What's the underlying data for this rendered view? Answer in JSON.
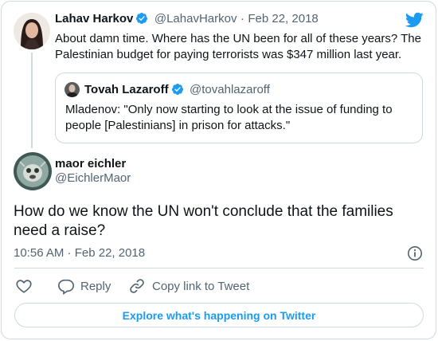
{
  "colors": {
    "accent": "#1d9bf0",
    "text": "#0f1419",
    "muted": "#536471",
    "border": "#cfd9de"
  },
  "parent_tweet": {
    "name": "Lahav Harkov",
    "handle": "@LahavHarkov",
    "separator": "·",
    "date": "Feb 22, 2018",
    "text_line1": "About damn time. Where has the UN been for all of these years? The",
    "text_line2": "Palestinian budget for paying terrorists was $347 million last year.",
    "quoted": {
      "name": "Tovah Lazaroff",
      "handle": "@tovahlazaroff",
      "text_line1": "Mladenov: \"Only now starting to look at the issue of funding to",
      "text_line2": "people [Palestinians] in prison for attacks.\""
    }
  },
  "main_tweet": {
    "name": "maor eichler",
    "handle": "@EichlerMaor",
    "text_line1": "How do we know the UN won't conclude that the families",
    "text_line2": "need a raise?",
    "timestamp": "10:56 AM · Feb 22, 2018"
  },
  "actions": {
    "reply": "Reply",
    "copy_link": "Copy link to Tweet"
  },
  "explore_label": "Explore what's happening on Twitter",
  "icons": [
    "twitter-bird-icon",
    "verified-badge-icon",
    "info-icon",
    "heart-icon",
    "reply-icon",
    "link-icon"
  ]
}
